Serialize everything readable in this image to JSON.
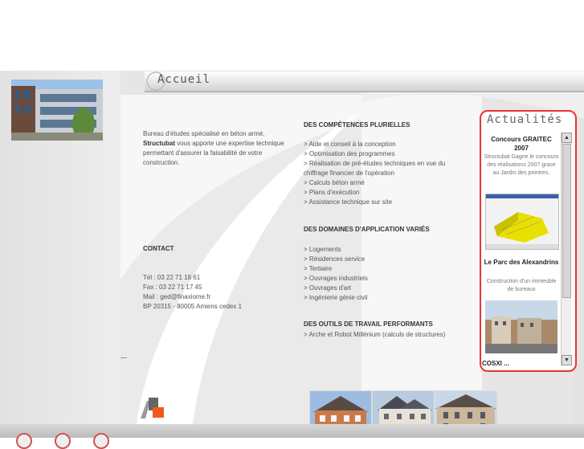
{
  "header": {
    "title": "Accueil"
  },
  "intro": {
    "line1": "Bureau d'études spécialisé en béton armé,",
    "brand": "Structubat",
    "rest": " vous apporte une expertise technique permettant d'assurer la faisabilité de votre construction."
  },
  "contact": {
    "title": "CONTACT",
    "tel": "Tél : 03 22 71 18 61",
    "fax": "Fax : 03 22 71 17 45",
    "mail": "Mail : ged@finaxiome.fr",
    "address": "BP 20315 - 80005 Amiens cedex 1"
  },
  "competences": {
    "title": "DES COMPÉTENCES PLURIELLES",
    "items": [
      "> Aide et conseil à la conception",
      "> Optimisation des programmes",
      "> Réalisation de pré-études techniques en vue du chiffrage financier de l'opération",
      "> Calculs béton armé",
      "> Plans d'exécution",
      "> Assistance technique sur site"
    ]
  },
  "domaines": {
    "title": "DES DOMAINES D'APPLICATION VARIÉS",
    "items": [
      "> Logements",
      "> Résidences service",
      "> Tertiaire",
      "> Ouvrages industriels",
      "> Ouvrages d'art",
      "> Ingénierie génie civil"
    ]
  },
  "outils": {
    "title": "DES OUTILS DE TRAVAIL PERFORMANTS",
    "items": [
      "> Arche et Robot Millénium (calculs de structures)"
    ]
  },
  "news": {
    "title": "Actualités",
    "items": [
      {
        "title": "Concours GRAITEC 2007",
        "text": "Structubat Gagne le concours des réalisations 2007 grace au Jardin des peintres."
      },
      {
        "title": "Le Parc des Alexandrins",
        "text": "Construction d'un immeuble de bureaux"
      },
      {
        "title": "COSXI ...",
        "text": ""
      }
    ],
    "scroll_up": "▲",
    "scroll_down": "▼"
  },
  "colors": {
    "accent": "#e33333",
    "logo_orange": "#f05a1a",
    "logo_grey": "#777777"
  }
}
